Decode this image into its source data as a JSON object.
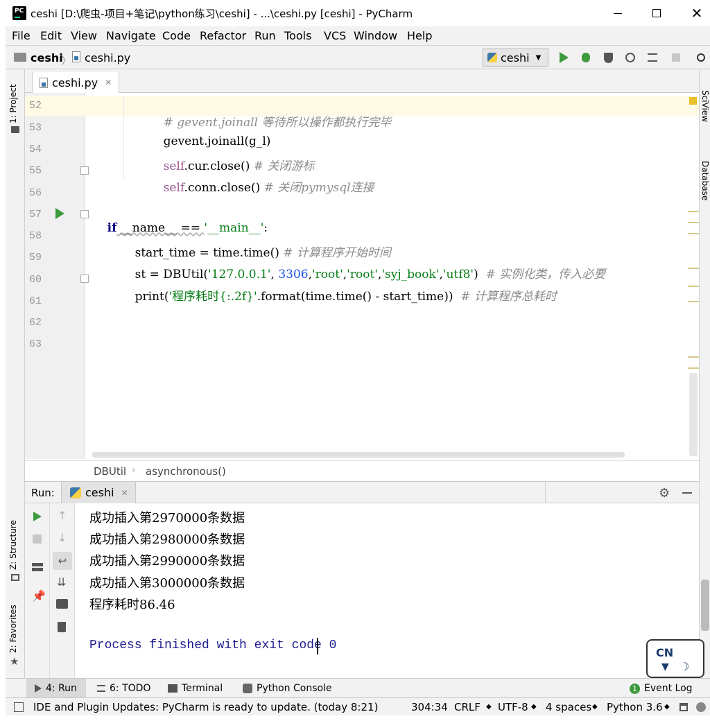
{
  "window": {
    "title": "ceshi [D:\\爬虫-项目+笔记\\python练习\\ceshi] - ...\\ceshi.py [ceshi] - PyCharm"
  },
  "menu": [
    "File",
    "Edit",
    "View",
    "Navigate",
    "Code",
    "Refactor",
    "Run",
    "Tools",
    "VCS",
    "Window",
    "Help"
  ],
  "nav": {
    "project": "ceshi",
    "file": "ceshi.py",
    "run_config": "ceshi"
  },
  "left_tabs": {
    "project": "1: Project",
    "structure": "Z: Structure",
    "favorites": "2: Favorites"
  },
  "right_tabs": {
    "sciview": "SciView",
    "database": "Database"
  },
  "editor_tab": {
    "label": "ceshi.py"
  },
  "editor": {
    "line_numbers": [
      "52",
      "53",
      "54",
      "55",
      "56",
      "57",
      "58",
      "59",
      "60",
      "61",
      "62",
      "63"
    ],
    "lines": {
      "l52_comment": "# gevent.joinall 等待所以操作都执行完毕",
      "l53_code": "gevent.joinall(g_l)",
      "l54_self": "self",
      "l54_code": ".cur.close()",
      "l54_comment": " # 关闭游标",
      "l55_self": "self",
      "l55_code": ".conn.close()",
      "l55_comment": " # 关闭pymysql连接",
      "l57_if": "if",
      "l57_name": " __name__ == ",
      "l57_str": "'__main__'",
      "l57_colon": ":",
      "l58_code": "start_time = time.time()",
      "l58_comment": " # 计算程序开始时间",
      "l59_code1": "st = DBUtil(",
      "l59_str1": "'127.0.0.1'",
      "l59_comma1": ", ",
      "l59_num": "3306",
      "l59_comma2": ",",
      "l59_str2": "'root'",
      "l59_comma3": ",",
      "l59_str3": "'root'",
      "l59_comma4": ",",
      "l59_str4": "'syj_book'",
      "l59_comma5": ",",
      "l59_str5": "'utf8'",
      "l59_close": ")",
      "l59_comment": "  # 实例化类，传入必要",
      "l60_code1": "print(",
      "l60_str": "'程序耗时{:.2f}'",
      "l60_code2": ".format(time.time() - start_time))",
      "l60_comment": "  # 计算程序总耗时"
    }
  },
  "breadcrumb": [
    "DBUtil",
    "asynchronous()"
  ],
  "run": {
    "label": "Run:",
    "tab": "ceshi",
    "output": [
      "成功插入第2970000条数据",
      "成功插入第2980000条数据",
      "成功插入第2990000条数据",
      "成功插入第3000000条数据",
      "程序耗时86.46",
      "",
      "Process finished with exit code 0"
    ]
  },
  "bottom_tabs": {
    "run": "4: Run",
    "todo": "6: TODO",
    "terminal": "Terminal",
    "python_console": "Python Console",
    "event_log": "Event Log",
    "event_count": "1"
  },
  "status": {
    "message": "IDE and Plugin Updates: PyCharm is ready to update. (today 8:21)",
    "position": "304:34",
    "line_sep": "CRLF",
    "encoding": "UTF-8",
    "indent": "4 spaces",
    "interpreter": "Python 3.6"
  },
  "overlay": {
    "badge": "CN"
  },
  "colors": {
    "keyword": "#000080",
    "string": "#067d17",
    "number": "#1750eb",
    "comment": "#8c8c8c",
    "self": "#94558d",
    "run_green": "#3d9a3d",
    "current_line": "#fffae3"
  }
}
